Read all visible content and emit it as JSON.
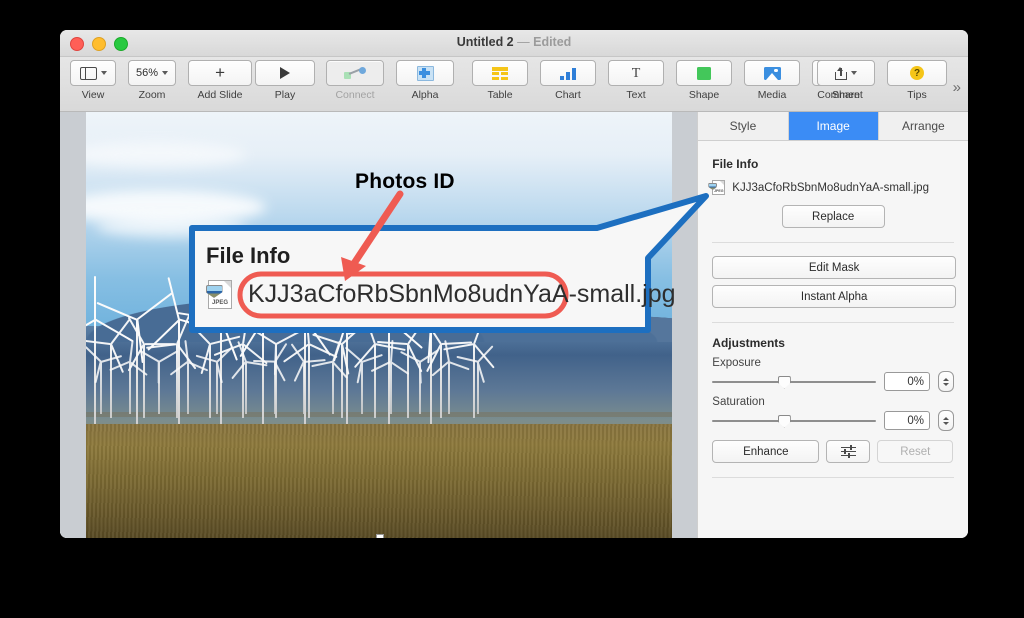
{
  "window": {
    "title": "Untitled 2",
    "dash": "—",
    "edited": "Edited",
    "traffic_lights": [
      "close-button",
      "minimize-button",
      "zoom-button"
    ]
  },
  "toolbar": {
    "items": [
      {
        "label": "View",
        "icon": "view-icon",
        "has_chevron": true
      },
      {
        "label": "Zoom",
        "icon": "zoom-level",
        "value": "56%",
        "has_chevron": true
      },
      {
        "label": "Add Slide",
        "icon": "plus-icon"
      },
      {
        "label": "Play",
        "icon": "play-icon"
      },
      {
        "label": "Connect",
        "icon": "connect-icon",
        "dim": true
      },
      {
        "label": "Alpha",
        "icon": "alpha-icon"
      },
      {
        "label": "Table",
        "icon": "table-icon"
      },
      {
        "label": "Chart",
        "icon": "chart-icon"
      },
      {
        "label": "Text",
        "icon": "text-icon"
      },
      {
        "label": "Shape",
        "icon": "shape-icon"
      },
      {
        "label": "Media",
        "icon": "media-icon"
      },
      {
        "label": "Comment",
        "icon": "comment-icon"
      },
      {
        "label": "Share",
        "icon": "share-icon",
        "has_chevron": true
      },
      {
        "label": "Tips",
        "icon": "tips-icon"
      }
    ],
    "overflow": "»"
  },
  "sidebar": {
    "tabs": [
      {
        "label": "Style",
        "active": false
      },
      {
        "label": "Image",
        "active": true
      },
      {
        "label": "Arrange",
        "active": false
      }
    ],
    "file_info": {
      "heading": "File Info",
      "file_name": "KJJ3aCfoRbSbnMo8udnYaA-small.jpg",
      "file_icon_label": "JPEG",
      "replace_label": "Replace"
    },
    "mask_buttons": [
      {
        "label": "Edit Mask"
      },
      {
        "label": "Instant Alpha"
      }
    ],
    "adjustments": {
      "heading": "Adjustments",
      "sliders": [
        {
          "label": "Exposure",
          "value": "0%",
          "position_pct": 44
        },
        {
          "label": "Saturation",
          "value": "0%",
          "position_pct": 44
        }
      ],
      "enhance_label": "Enhance",
      "options_icon": "sliders-icon",
      "reset_label": "Reset",
      "reset_disabled": true
    }
  },
  "callout": {
    "annotation_label": "Photos ID",
    "heading": "File Info",
    "file_name": "KJJ3aCfoRbSbnMo8udnYaA-small.jpg",
    "file_icon_label": "JPEG",
    "highlight_text": "KJJ3aCfoRbSbnMo8udnYaA",
    "border_color": "#1d6fc0",
    "highlight_color": "#ef5b52",
    "arrow_color": "#ef5b52"
  },
  "canvas": {
    "slide_image": "wind-turbine-farm-photo",
    "selection_handle": "bottom-center-handle"
  }
}
